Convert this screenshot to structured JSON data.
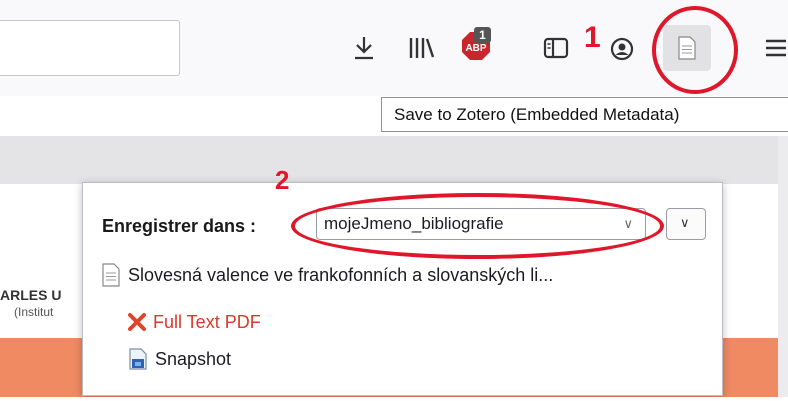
{
  "toolbar": {
    "icons": [
      "download-icon",
      "library-icon",
      "adblock-plus-icon",
      "sidebar-icon",
      "account-icon",
      "zotero-save-icon",
      "hamburger-menu-icon"
    ],
    "adblock_badge": "1",
    "annotation_1": "1",
    "tooltip": "Save to Zotero (Embedded Metadata)"
  },
  "page": {
    "side_text_1": "ARLES U",
    "side_text_2": "(Institut"
  },
  "popup": {
    "save_label": "Enregistrer dans :",
    "annotation_2": "2",
    "collection_selected": "mojeJmeno_bibliografie",
    "item_title": "Slovesná valence ve frankofonních a slovanských li...",
    "attachments": [
      {
        "label": "Full Text PDF",
        "icon": "failed-x-icon",
        "color": "#d93a28"
      },
      {
        "label": "Snapshot",
        "icon": "snapshot-icon",
        "color": "#1a1a1a"
      }
    ]
  },
  "colors": {
    "annotation_red": "#e0162b",
    "page_orange": "#f08a63"
  }
}
